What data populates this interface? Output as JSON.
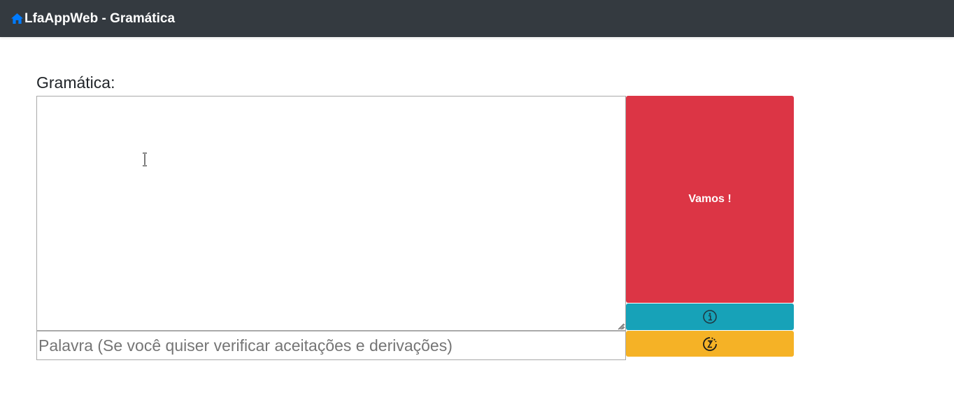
{
  "navbar": {
    "icon": "home-icon",
    "brand": "LfaAppWeb - Gramática",
    "background": "#343a40",
    "icon_color": "#007bff"
  },
  "main": {
    "grammar_label": "Gramática:",
    "grammar_value": "",
    "word_input": {
      "value": "",
      "placeholder": "Palavra (Se você quiser verificar aceitações e derivações)"
    },
    "buttons": {
      "go_label": "Vamos !",
      "go_color": "#dc3545",
      "info_icon": "info-icon",
      "info_color": "#17a2b8",
      "steps_icon": "steps-timer-icon",
      "steps_color": "#f5b226"
    }
  }
}
